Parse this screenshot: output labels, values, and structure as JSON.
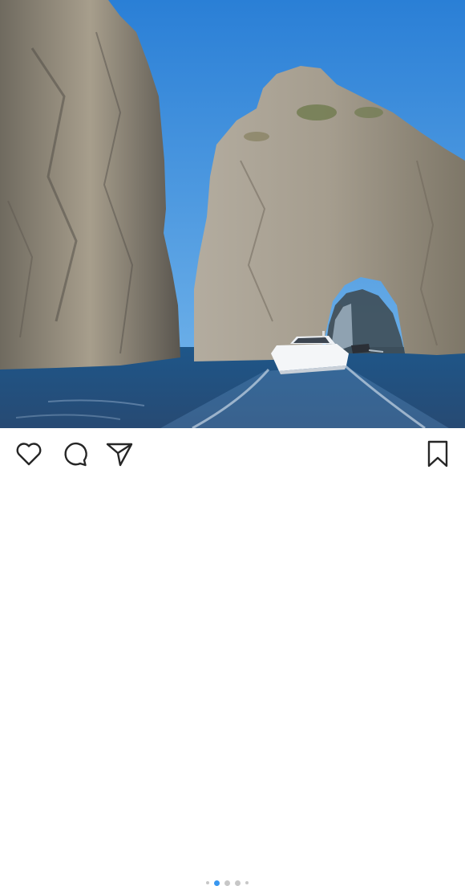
{
  "post": {
    "photo": {
      "subject": "sea-stacks-photo"
    },
    "actions": {
      "like_icon": "heart-icon",
      "comment_icon": "speech-bubble-icon",
      "share_icon": "paper-plane-icon",
      "save_icon": "bookmark-icon"
    },
    "carousel": {
      "dot_count": 5,
      "active_index": 1,
      "active_color": "#3897f0",
      "inactive_color": "#c7c7c7"
    }
  },
  "colors": {
    "sky": "#2f87d8",
    "sea": "#1f4f7f",
    "rock": "#9a9182",
    "icon": "#262626"
  }
}
